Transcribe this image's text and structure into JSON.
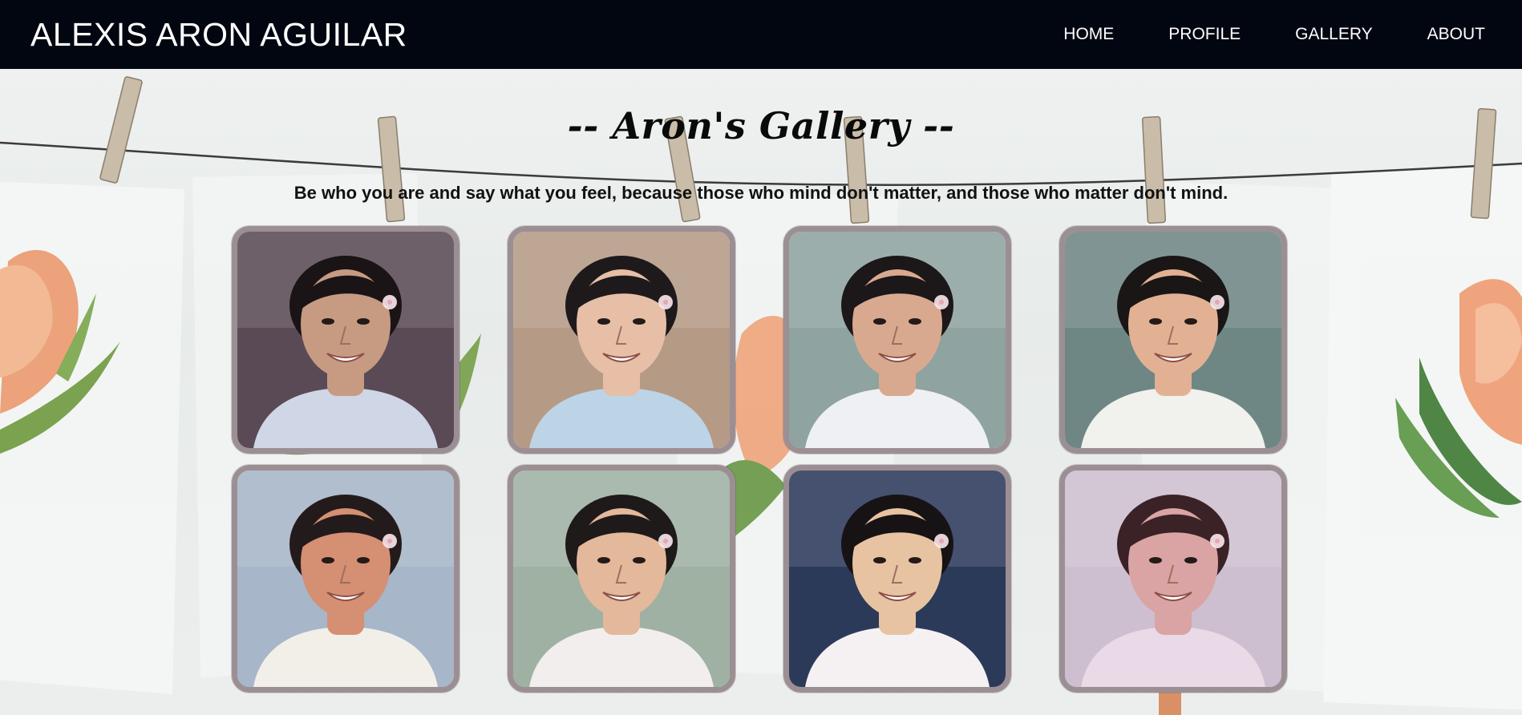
{
  "navbar": {
    "brand": "ALEXIS ARON AGUILAR",
    "links": [
      "HOME",
      "PROFILE",
      "GALLERY",
      "ABOUT"
    ]
  },
  "gallery": {
    "title": "-- Aron's Gallery --",
    "quote": "Be who you are and say what you feel, because those who mind don't matter, and those who matter don't mind.",
    "photos": [
      {
        "bg": "#5a4a55",
        "skin": "#c79b82",
        "hair": "#1b1416",
        "shirt": "#cfd6e6"
      },
      {
        "bg": "#b59a86",
        "skin": "#e6bfa6",
        "hair": "#1e1a1c",
        "shirt": "#bcd4e6"
      },
      {
        "bg": "#8fa3a0",
        "skin": "#d9a98f",
        "hair": "#1c1718",
        "shirt": "#eef0f4"
      },
      {
        "bg": "#6f8784",
        "skin": "#e2b194",
        "hair": "#1a1616",
        "shirt": "#f1f1ee"
      },
      {
        "bg": "#a7b6c8",
        "skin": "#d58f72",
        "hair": "#231b1b",
        "shirt": "#f2efe9"
      },
      {
        "bg": "#9fb1a3",
        "skin": "#e3b89b",
        "hair": "#1f1a1a",
        "shirt": "#f3eeee"
      },
      {
        "bg": "#2c3a5a",
        "skin": "#e8c3a2",
        "hair": "#171315",
        "shirt": "#f5f1f3"
      },
      {
        "bg": "#cdbfd0",
        "skin": "#d9a4a3",
        "hair": "#3a2227",
        "shirt": "#ead9e6"
      }
    ]
  },
  "colors": {
    "nav_bg": "#020611",
    "frame": "#9c8f94",
    "text": "#111111"
  }
}
